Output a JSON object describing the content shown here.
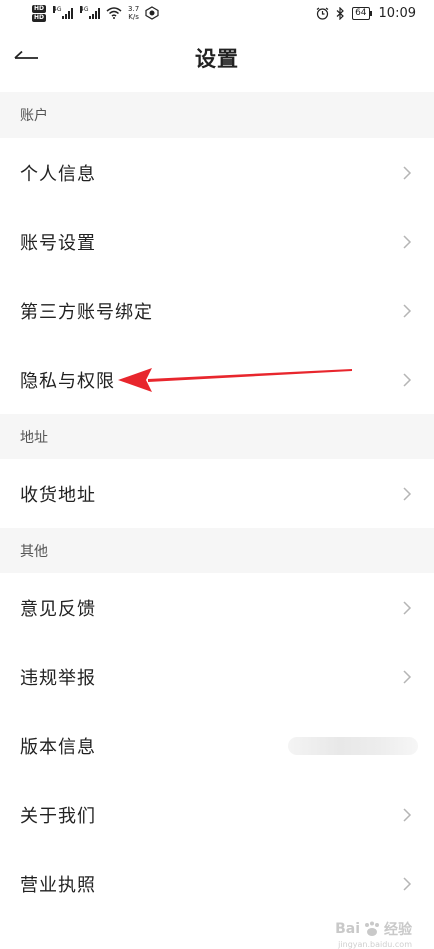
{
  "status_bar": {
    "hd1": "HD",
    "hd2": "HD",
    "net1": "4G",
    "net2": "4G",
    "speed_value": "3.7",
    "speed_unit": "K/s",
    "battery": "64",
    "time": "10:09"
  },
  "header": {
    "title": "设置"
  },
  "sections": [
    {
      "title": "账户",
      "items": [
        "个人信息",
        "账号设置",
        "第三方账号绑定",
        "隐私与权限"
      ]
    },
    {
      "title": "地址",
      "items": [
        "收货地址"
      ]
    },
    {
      "title": "其他",
      "items": [
        "意见反馈",
        "违规举报",
        "版本信息",
        "关于我们",
        "营业执照"
      ]
    }
  ],
  "annotation": {
    "arrow_color": "#e8262d",
    "target": "隐私与权限"
  },
  "watermark": {
    "brand": "Bai",
    "brand2": "经验",
    "sub": "jingyan.baidu.com"
  },
  "colors": {
    "section_bg": "#f6f6f6",
    "text": "#222222",
    "chevron": "#b5b5b5"
  }
}
